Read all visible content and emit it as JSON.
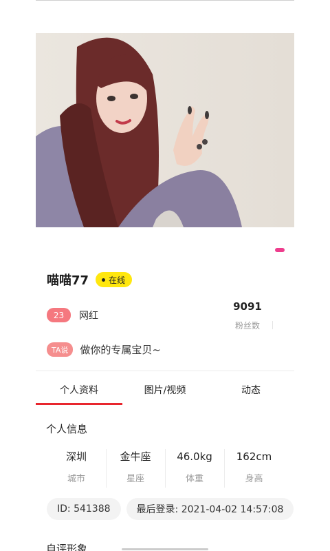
{
  "profile": {
    "name": "喵喵77",
    "status": "在线",
    "age": "23",
    "role": "网红",
    "fans_count": "9091",
    "fans_label": "粉丝数",
    "ta_label": "TA说",
    "quote": "做你的专属宝贝~"
  },
  "tabs": [
    {
      "label": "个人资料",
      "active": true
    },
    {
      "label": "图片/视频",
      "active": false
    },
    {
      "label": "动态",
      "active": false
    }
  ],
  "personal_info": {
    "title": "个人信息",
    "stats": [
      {
        "value": "深圳",
        "label": "城市"
      },
      {
        "value": "金牛座",
        "label": "星座"
      },
      {
        "value": "46.0kg",
        "label": "体重"
      },
      {
        "value": "162cm",
        "label": "身高"
      }
    ],
    "id_chip": "ID: 541388",
    "last_login_chip": "最后登录: 2021-04-02 14:57:08"
  },
  "next_section_title": "自评形象",
  "colors": {
    "accent": "#e8262e",
    "online": "#ffe70f",
    "age_badge": "#f5787f",
    "ta_badge": "#f58e8e",
    "page_indicator": "#ee3d8d"
  }
}
